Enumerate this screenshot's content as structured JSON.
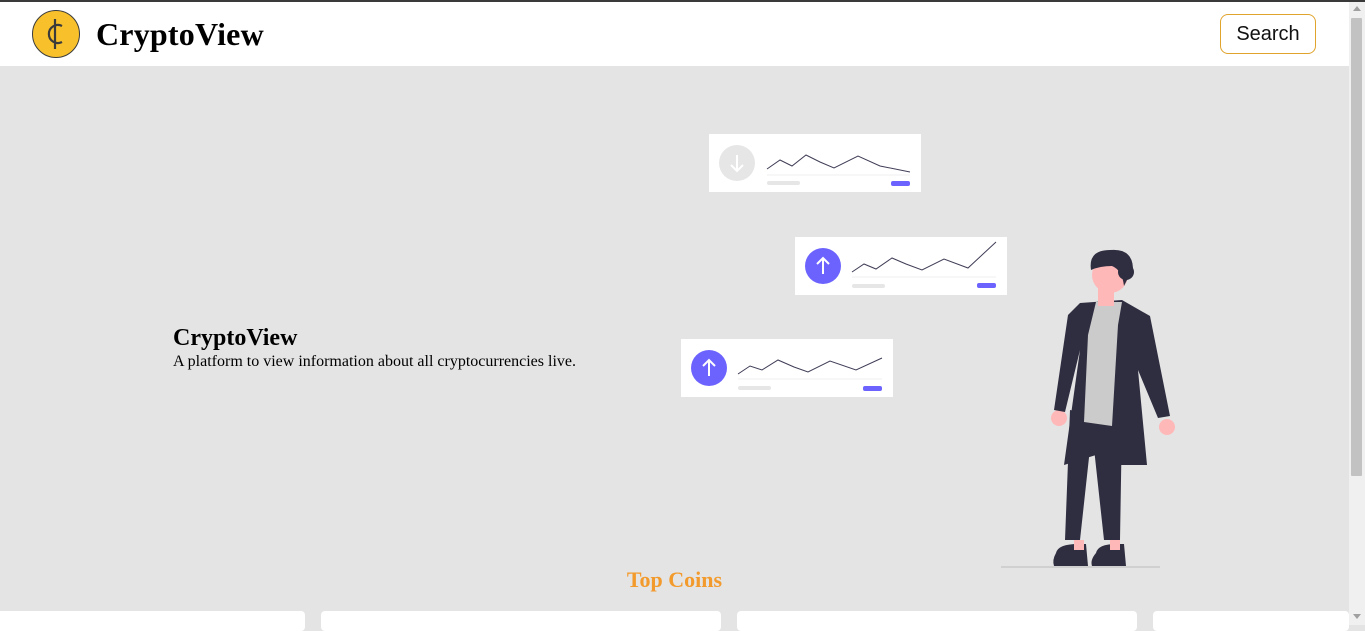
{
  "navbar": {
    "brand": "CryptoView",
    "logo_icon": "cent-coin-icon",
    "search_label": "Search"
  },
  "hero": {
    "title": "CryptoView",
    "subtitle": "A platform to view information about all cryptocurrencies live."
  },
  "top_coins": {
    "heading": "Top Coins"
  },
  "colors": {
    "accent": "#f39a2c",
    "coin": "#f8c12c",
    "chart_purple": "#6c63ff",
    "background": "#e4e4e4"
  }
}
